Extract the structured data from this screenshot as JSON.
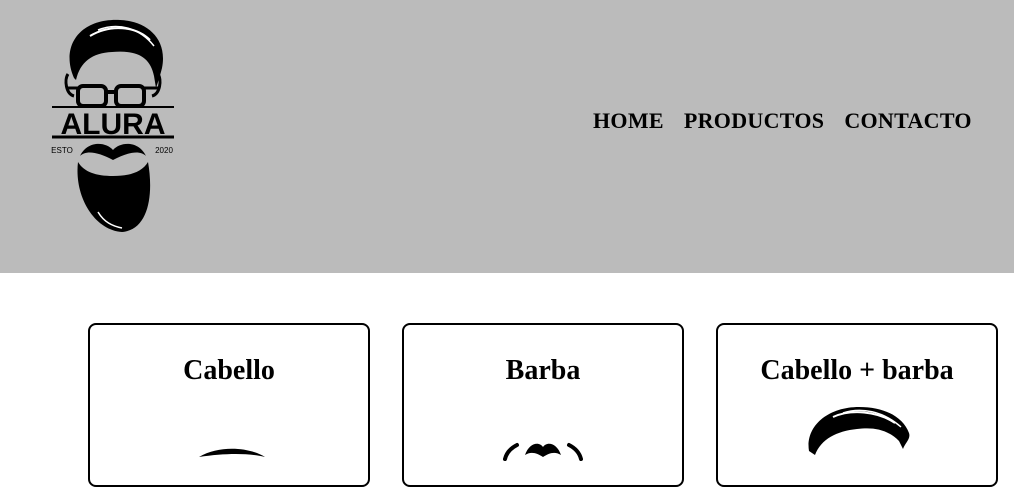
{
  "header": {
    "logo": {
      "text": "ALURA",
      "left_caption": "ESTO",
      "right_caption": "2020",
      "icon": "bearded-man-logo"
    },
    "nav": [
      {
        "label": "HOME"
      },
      {
        "label": "PRODUCTOS"
      },
      {
        "label": "CONTACTO"
      }
    ],
    "background_color": "#bbbbbb"
  },
  "products": [
    {
      "title": "Cabello",
      "icon": "hair-icon"
    },
    {
      "title": "Barba",
      "icon": "beard-icon"
    },
    {
      "title": "Cabello + barba",
      "icon": "hair-and-beard-icon"
    }
  ]
}
